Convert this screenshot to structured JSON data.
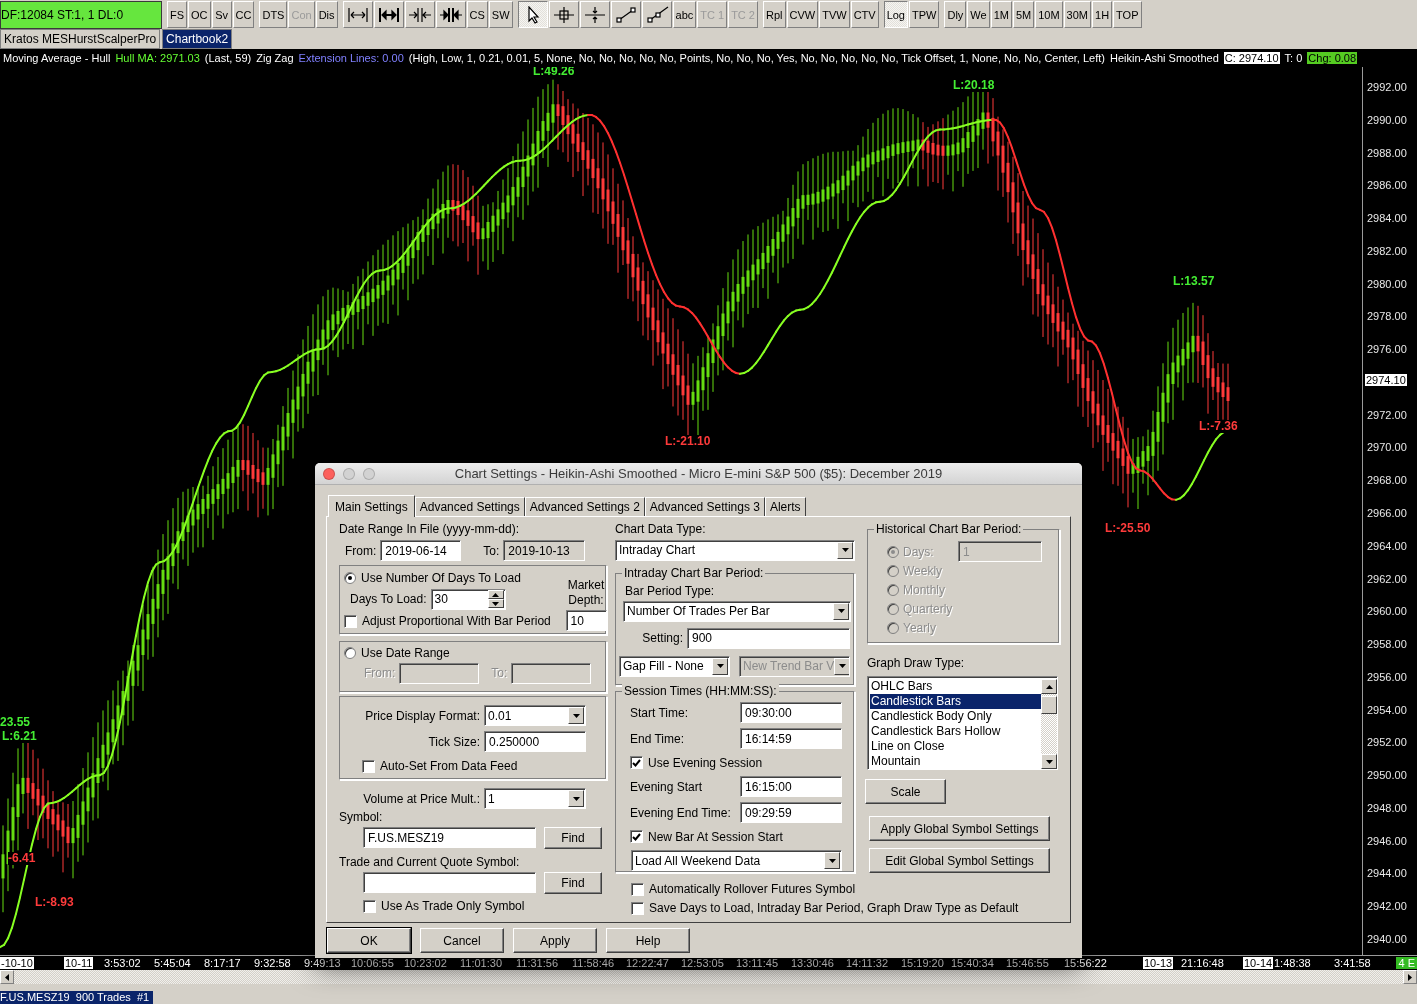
{
  "toolbar": {
    "status": "DF:12084  ST:1, 1  DL:0",
    "groups": [
      [
        {
          "kind": "text",
          "label": "FS",
          "selected": false,
          "disabled": false
        },
        {
          "kind": "text",
          "label": "OC",
          "selected": false,
          "disabled": false
        },
        {
          "kind": "text",
          "label": "Sv",
          "selected": false,
          "disabled": false
        },
        {
          "kind": "text",
          "label": "CC",
          "selected": false,
          "disabled": false
        }
      ],
      [
        {
          "kind": "text",
          "label": "DTS",
          "selected": false,
          "disabled": false
        },
        {
          "kind": "text",
          "label": "Con",
          "selected": false,
          "disabled": true
        },
        {
          "kind": "text",
          "label": "Dis",
          "selected": false,
          "disabled": false
        }
      ],
      [
        {
          "kind": "icon",
          "selected": false,
          "disabled": false
        },
        {
          "kind": "icon",
          "selected": false,
          "disabled": false
        },
        {
          "kind": "icon",
          "selected": false,
          "disabled": false
        },
        {
          "kind": "icon",
          "selected": false,
          "disabled": false
        },
        {
          "kind": "text",
          "label": "CS",
          "selected": false,
          "disabled": false
        },
        {
          "kind": "text",
          "label": "SW",
          "selected": false,
          "disabled": false
        }
      ],
      [
        {
          "kind": "icon",
          "selected": true,
          "disabled": false
        },
        {
          "kind": "icon",
          "selected": false,
          "disabled": false
        },
        {
          "kind": "icon",
          "selected": false,
          "disabled": false
        },
        {
          "kind": "icon",
          "selected": false,
          "disabled": false
        },
        {
          "kind": "icon",
          "selected": false,
          "disabled": false
        },
        {
          "kind": "text",
          "label": "abc",
          "selected": false,
          "disabled": false
        },
        {
          "kind": "text",
          "label": "TC 1",
          "selected": false,
          "disabled": true
        },
        {
          "kind": "text",
          "label": "TC 2",
          "selected": false,
          "disabled": true
        }
      ],
      [
        {
          "kind": "text",
          "label": "Rpl",
          "selected": false,
          "disabled": false
        },
        {
          "kind": "text",
          "label": "CVW",
          "selected": false,
          "disabled": false
        },
        {
          "kind": "text",
          "label": "TVW",
          "selected": false,
          "disabled": false
        },
        {
          "kind": "text",
          "label": "CTV",
          "selected": false,
          "disabled": false
        }
      ],
      [
        {
          "kind": "text",
          "label": "Log",
          "selected": true,
          "disabled": false
        },
        {
          "kind": "text",
          "label": "TPW",
          "selected": false,
          "disabled": false
        }
      ],
      [
        {
          "kind": "text",
          "label": "Dly",
          "selected": false,
          "disabled": false
        },
        {
          "kind": "text",
          "label": "We",
          "selected": false,
          "disabled": false
        },
        {
          "kind": "text",
          "label": "1M",
          "selected": false,
          "disabled": false
        },
        {
          "kind": "text",
          "label": "5M",
          "selected": false,
          "disabled": false
        },
        {
          "kind": "text",
          "label": "10M",
          "selected": false,
          "disabled": false
        },
        {
          "kind": "text",
          "label": "30M",
          "selected": false,
          "disabled": false
        },
        {
          "kind": "text",
          "label": "1H",
          "selected": false,
          "disabled": false
        },
        {
          "kind": "text",
          "label": "TOP",
          "selected": false,
          "disabled": false
        }
      ]
    ]
  },
  "chartbook_tabs": [
    {
      "label": "Kratos MESHurstScalperPro",
      "selected": false
    },
    {
      "label": "Chartbook2",
      "selected": true
    }
  ],
  "study_bar": [
    {
      "kind": "plain",
      "text": "Moving Average - Hull"
    },
    {
      "kind": "green",
      "text": "Hull MA: 2971.03"
    },
    {
      "kind": "plain",
      "text": "(Last, 59)"
    },
    {
      "kind": "plain",
      "text": "Zig Zag"
    },
    {
      "kind": "blue",
      "text": "Extension Lines: 0.00"
    },
    {
      "kind": "plain",
      "text": "(High, Low, 1, 0.21, 0.01, 5, None, No, No, No, No, No, Points, No, No, No, Yes, No, No, No, No, No, Tick Offset, 1, None, No, No, Center, Left)"
    },
    {
      "kind": "plain",
      "text": "Heikin-Ashi Smoothed"
    },
    {
      "kind": "white_box",
      "text": "C: 2974.10"
    },
    {
      "kind": "plain",
      "text": "T: 0"
    },
    {
      "kind": "green_box",
      "text": "Chg: 0.08"
    }
  ],
  "chart": {
    "price_labels": [
      "2992.00",
      "2990.00",
      "2988.00",
      "2986.00",
      "2984.00",
      "2982.00",
      "2980.00",
      "2978.00",
      "2976.00",
      "2972.00",
      "2970.00",
      "2968.00",
      "2966.00",
      "2964.00",
      "2962.00",
      "2960.00",
      "2958.00",
      "2956.00",
      "2954.00",
      "2952.00",
      "2950.00",
      "2948.00",
      "2946.00",
      "2944.00",
      "2942.00",
      "2940.00"
    ],
    "current_price": "2974.10",
    "zigzag_labels": [
      {
        "kind": "high",
        "text": "L:49.26"
      },
      {
        "kind": "low",
        "text": "L:-21.10"
      },
      {
        "kind": "high",
        "text": "L:20.18"
      },
      {
        "kind": "high",
        "text": "L:13.57"
      },
      {
        "kind": "low",
        "text": "L:-7.36"
      },
      {
        "kind": "low",
        "text": "L:-25.50"
      },
      {
        "kind": "high",
        "text": "23.55"
      },
      {
        "kind": "high",
        "text": "L:6.21"
      },
      {
        "kind": "low",
        "text": "-6.41"
      },
      {
        "kind": "low",
        "text": "L:-8.93"
      }
    ],
    "time_labels": [
      {
        "kind": "date",
        "text": "-10-10"
      },
      {
        "kind": "date",
        "text": "10-11"
      },
      {
        "kind": "time",
        "text": "3:53:02"
      },
      {
        "kind": "time",
        "text": "5:45:04"
      },
      {
        "kind": "time",
        "text": "8:17:17"
      },
      {
        "kind": "time",
        "text": "9:32:58"
      },
      {
        "kind": "time",
        "text": "9:49:13"
      },
      {
        "kind": "time",
        "text": "10:06:55"
      },
      {
        "kind": "time",
        "text": "10:23:02"
      },
      {
        "kind": "time",
        "text": "11:01:30"
      },
      {
        "kind": "time",
        "text": "11:31:56"
      },
      {
        "kind": "time",
        "text": "11:58:46"
      },
      {
        "kind": "time",
        "text": "12:22:47"
      },
      {
        "kind": "time",
        "text": "12:53:05"
      },
      {
        "kind": "time",
        "text": "13:11:45"
      },
      {
        "kind": "time",
        "text": "13:30:46"
      },
      {
        "kind": "time",
        "text": "14:11:32"
      },
      {
        "kind": "time",
        "text": "15:19:20"
      },
      {
        "kind": "time",
        "text": "15:40:34"
      },
      {
        "kind": "time",
        "text": "15:46:55"
      },
      {
        "kind": "time",
        "text": "15:56:22"
      },
      {
        "kind": "date",
        "text": "10-13"
      },
      {
        "kind": "time",
        "text": "21:16:48"
      },
      {
        "kind": "date",
        "text": "10-14"
      },
      {
        "kind": "time",
        "text": "1:48:38"
      },
      {
        "kind": "time",
        "text": "3:41:58"
      }
    ],
    "corner_badge": "4 E"
  },
  "status_tab": "F.US.MESZ19  900 Trades  #1",
  "dialog": {
    "title": "Chart Settings - Heikin-Ashi Smoothed - Micro E-mini S&P 500 ($5): December 2019",
    "tabs": [
      {
        "label": "Main Settings",
        "selected": true
      },
      {
        "label": "Advanced Settings",
        "selected": false
      },
      {
        "label": "Advanced Settings 2",
        "selected": false
      },
      {
        "label": "Advanced Settings 3",
        "selected": false
      },
      {
        "label": "Alerts",
        "selected": false
      }
    ],
    "date_range": {
      "heading": "Date Range In File (yyyy-mm-dd):",
      "from_label": "From:",
      "from": {
        "value": "2019-06-14",
        "readonly": false
      },
      "to_label": "To:",
      "to": {
        "value": "2019-10-13",
        "readonly": true
      }
    },
    "days_mode": {
      "label": "Use Number Of Days To Load",
      "selected": true,
      "days_label": "Days To Load:",
      "days": "30",
      "adjust": {
        "label": "Adjust Proportional With Bar Period",
        "checked": false
      },
      "depth_label": "Market Depth:",
      "depth": "10"
    },
    "range_mode": {
      "label": "Use Date Range",
      "selected": false,
      "from_label": "From:",
      "to_label": "To:"
    },
    "price_format": {
      "label": "Price Display Format:",
      "value": "0.01"
    },
    "tick_size": {
      "label": "Tick Size:",
      "value": "0.250000"
    },
    "auto_set": {
      "label": "Auto-Set From Data Feed",
      "checked": false
    },
    "vap_mult": {
      "label": "Volume at Price Mult.:",
      "value": "1"
    },
    "symbol": {
      "label": "Symbol:",
      "value": "F.US.MESZ19",
      "button": "Find"
    },
    "quote_symbol": {
      "label": "Trade and Current Quote Symbol:",
      "button": "Find"
    },
    "trade_only": {
      "label": "Use As Trade Only Symbol",
      "checked": false
    },
    "data_type": {
      "label": "Chart Data Type:",
      "value": "Intraday Chart"
    },
    "intraday": {
      "legend": "Intraday Chart Bar Period:",
      "type_label": "Bar Period Type:",
      "type": "Number Of Trades Per Bar",
      "setting_label": "Setting:",
      "setting": "900",
      "gap_fill": {
        "value": "Gap Fill - None",
        "disabled": false
      },
      "new_trend": {
        "value": "New Trend Bar V",
        "disabled": true
      }
    },
    "session": {
      "legend": "Session Times (HH:MM:SS):",
      "rows": [
        {
          "kind": "field",
          "label": "Start Time:",
          "value": "09:30:00"
        },
        {
          "kind": "field",
          "label": "End Time:",
          "value": "16:14:59"
        },
        {
          "kind": "check",
          "label": "Use Evening Session",
          "checked": true
        },
        {
          "kind": "field",
          "label": "Evening Start",
          "value": "16:15:00"
        },
        {
          "kind": "field",
          "label": "Evening End Time:",
          "value": "09:29:59"
        },
        {
          "kind": "check",
          "label": "New Bar At Session Start",
          "checked": true
        },
        {
          "kind": "select",
          "value": "Load All Weekend Data"
        }
      ]
    },
    "bottom_checks": [
      {
        "label": "Automatically Rollover Futures Symbol",
        "checked": false
      },
      {
        "label": "Save Days to Load, Intraday Bar Period, Graph Draw Type as Default",
        "checked": false
      }
    ],
    "historical": {
      "legend": "Historical Chart Bar Period:",
      "disabled": true,
      "days_value": "1",
      "options": [
        {
          "label": "Days:",
          "selected": true
        },
        {
          "label": "Weekly",
          "selected": false
        },
        {
          "label": "Monthly",
          "selected": false
        },
        {
          "label": "Quarterly",
          "selected": false
        },
        {
          "label": "Yearly",
          "selected": false
        }
      ]
    },
    "draw_type": {
      "label": "Graph Draw Type:",
      "items": [
        {
          "label": "OHLC Bars",
          "selected": false
        },
        {
          "label": "Candlestick Bars",
          "selected": true
        },
        {
          "label": "Candlestick Body Only",
          "selected": false
        },
        {
          "label": "Candlestick Bars Hollow",
          "selected": false
        },
        {
          "label": "Line on Close",
          "selected": false
        },
        {
          "label": "Mountain",
          "selected": false
        }
      ]
    },
    "side_buttons": [
      "Scale",
      "Apply Global Symbol Settings",
      "Edit Global Symbol Settings"
    ],
    "buttons": [
      {
        "label": "OK",
        "default": true
      },
      {
        "label": "Cancel",
        "default": false
      },
      {
        "label": "Apply",
        "default": false
      },
      {
        "label": "Help",
        "default": false
      }
    ]
  }
}
